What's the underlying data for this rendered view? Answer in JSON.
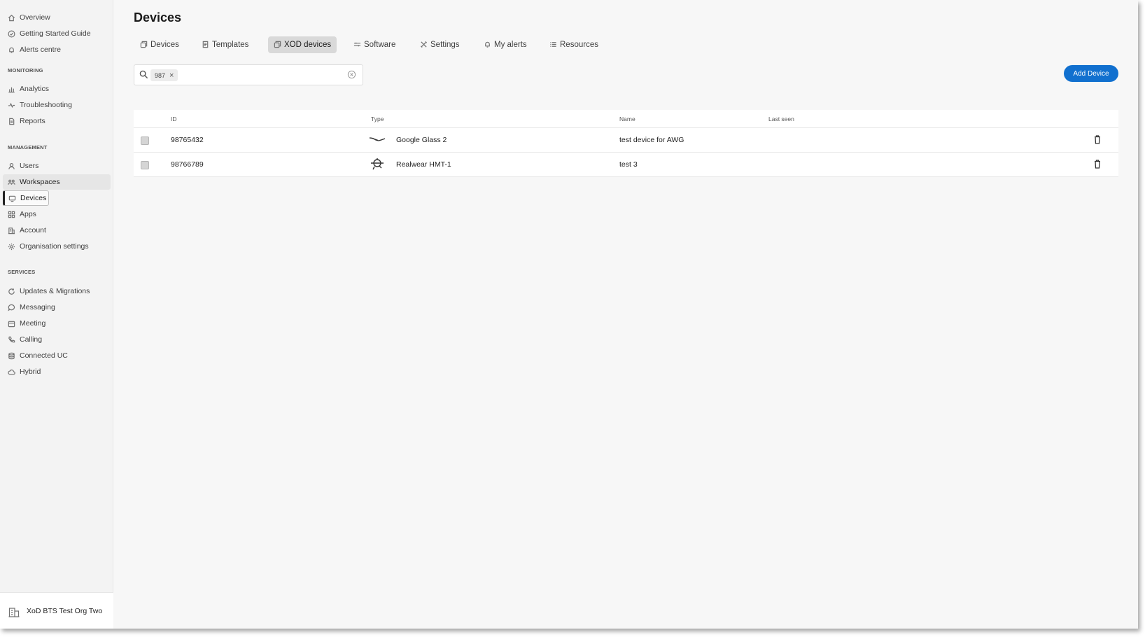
{
  "sidebar": {
    "top_items": [
      {
        "label": "Overview",
        "icon": "home-icon"
      },
      {
        "label": "Getting Started Guide",
        "icon": "check-circle-icon"
      },
      {
        "label": "Alerts centre",
        "icon": "bell-icon"
      }
    ],
    "sections": [
      {
        "label": "MONITORING",
        "items": [
          {
            "label": "Analytics",
            "icon": "bar-chart-icon"
          },
          {
            "label": "Troubleshooting",
            "icon": "pulse-icon"
          },
          {
            "label": "Reports",
            "icon": "document-icon"
          }
        ]
      },
      {
        "label": "MANAGEMENT",
        "items": [
          {
            "label": "Users",
            "icon": "user-icon"
          },
          {
            "label": "Workspaces",
            "icon": "workspaces-icon",
            "selected": true
          },
          {
            "label": "Devices",
            "icon": "device-icon",
            "focused": true
          },
          {
            "label": "Apps",
            "icon": "apps-grid-icon"
          },
          {
            "label": "Account",
            "icon": "building-icon"
          },
          {
            "label": "Organisation settings",
            "icon": "gear-icon"
          }
        ]
      },
      {
        "label": "SERVICES",
        "items": [
          {
            "label": "Updates & Migrations",
            "icon": "refresh-icon"
          },
          {
            "label": "Messaging",
            "icon": "chat-bubble-icon"
          },
          {
            "label": "Meeting",
            "icon": "calendar-icon"
          },
          {
            "label": "Calling",
            "icon": "phone-icon"
          },
          {
            "label": "Connected UC",
            "icon": "database-icon"
          },
          {
            "label": "Hybrid",
            "icon": "cloud-icon"
          }
        ]
      }
    ],
    "org_name": "XoD BTS Test Org Two"
  },
  "page": {
    "title": "Devices",
    "tabs": [
      {
        "label": "Devices",
        "icon": "devices-icon"
      },
      {
        "label": "Templates",
        "icon": "template-icon"
      },
      {
        "label": "XOD devices",
        "icon": "devices-icon",
        "active": true
      },
      {
        "label": "Software",
        "icon": "sliders-icon"
      },
      {
        "label": "Settings",
        "icon": "tools-icon"
      },
      {
        "label": "My alerts",
        "icon": "bell-icon"
      },
      {
        "label": "Resources",
        "icon": "list-icon"
      }
    ],
    "search": {
      "chip": "987"
    },
    "add_button": "Add Device"
  },
  "table": {
    "columns": [
      "ID",
      "Type",
      "Name",
      "Last seen"
    ],
    "rows": [
      {
        "id": "98765432",
        "type": "Google Glass 2",
        "type_icon": "glasses-icon",
        "name": "test device for AWG",
        "last_seen": ""
      },
      {
        "id": "98766789",
        "type": "Realwear HMT-1",
        "type_icon": "headset-icon",
        "name": "test 3",
        "last_seen": ""
      }
    ]
  },
  "colors": {
    "accent": "#1170cf",
    "sidebar_bg": "#f3f3f3",
    "page_bg": "#f7f7f7",
    "active_tab_bg": "#d9d9d9"
  }
}
